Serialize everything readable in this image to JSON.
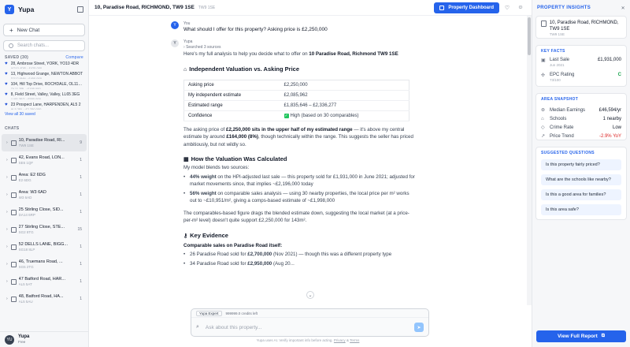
{
  "app": {
    "name": "Yupa",
    "logo_letter": "Y"
  },
  "sidebar": {
    "new_chat": "New Chat",
    "search_placeholder": "Search chats...",
    "saved_label": "SAVED (30)",
    "compare": "Compare",
    "saved": [
      {
        "addr": "28, Ambrose Street, YORK, YO10 4DR",
        "sub": "YO10 4DR · £425,000"
      },
      {
        "addr": "13, Highwood Grange, NEWTON ABBOT",
        "sub": "TQ12 6NN · £450,000"
      },
      {
        "addr": "104, Hill Top Drive, ROCHDALE, OL11 2RL",
        "sub": "OL11 2RL · £195,000"
      },
      {
        "addr": "8, Field Street, Valley, Valley, LL65 3EG",
        "sub": "LL65 3EG · £550,000"
      },
      {
        "addr": "23 Prospect Lane, HARPENDEN, AL5 2",
        "sub": "AL5 2PL · £2,250,000"
      }
    ],
    "view_all": "View all 30 saved",
    "chats_label": "CHATS",
    "chats": [
      {
        "title": "10, Paradise Road, RI...",
        "sub": "TW9 1SE",
        "count": "9"
      },
      {
        "title": "42, Evans Road, LON...",
        "sub": "SE6 1QF",
        "count": "1"
      },
      {
        "title": "Area: E2 6DG",
        "sub": "E2 6DG",
        "count": "1"
      },
      {
        "title": "Area: W3 6AD",
        "sub": "W3 6AD",
        "count": "1"
      },
      {
        "title": "25 Stirling Close, SID...",
        "sub": "DA14 6RP",
        "count": "1"
      },
      {
        "title": "27 Stirling Close, STE...",
        "sub": "SG2 8TG",
        "count": "15"
      },
      {
        "title": "52 DELLS LANE, BIGG...",
        "sub": "SG18 8LP",
        "count": "1"
      },
      {
        "title": "46, Truemans Road, ...",
        "sub": "SG5 2TG",
        "count": "1"
      },
      {
        "title": "47 Batford Road, HAR...",
        "sub": "AL5 5AT",
        "count": "1"
      },
      {
        "title": "48, Batford Road, HA...",
        "sub": "AL5 5AU",
        "count": "1"
      }
    ],
    "user_initials": "YU",
    "user_name": "Yupa",
    "user_plan": "Free"
  },
  "topbar": {
    "address": "10, Paradise Road, RICHMOND, TW9 1SE",
    "postcode": "TW9 1SE",
    "dashboard_btn": "Property Dashboard"
  },
  "conversation": {
    "user_label": "You",
    "user_initial": "Y",
    "user_message": "What should I offer for this property? Asking price is £2,250,000",
    "ai_label": "Yupa",
    "ai_initial": "Y",
    "sources": "Searched 3 sources",
    "intro_pre": "Here's my full analysis to help you decide what to offer on ",
    "intro_bold": "10 Paradise Road, Richmond TW9 1SE",
    "h_valuation": "Independent Valuation vs. Asking Price",
    "table": [
      {
        "k": "Asking price",
        "v": "£2,250,000"
      },
      {
        "k": "My independent estimate",
        "v": "£2,085,962"
      },
      {
        "k": "Estimated range",
        "v": "£1,835,646 – £2,336,277"
      },
      {
        "k": "Confidence",
        "v": "High (based on 30 comparables)"
      }
    ],
    "p2_a": "The asking price of ",
    "p2_b": "£2,250,000 sits in the upper half of my estimated range",
    "p2_c": " — it's above my central estimate by around ",
    "p2_d": "£164,000 (8%)",
    "p2_e": ", though technically within the range. This suggests the seller has priced ambitiously, but not wildly so.",
    "h_calc": "How the Valuation Was Calculated",
    "p3": "My model blends two sources:",
    "b1_bold": "44% weight",
    "b1": " on the HPI-adjusted last sale — this property sold for £1,931,000 in June 2021; adjusted for market movements since, that implies ~£2,196,000 today",
    "b2_bold": "56% weight",
    "b2": " on comparable sales analysis — using 30 nearby properties, the local price per m² works out to ~£10,951/m², giving a comps-based estimate of ~£1,998,000",
    "p4": "The comparables-based figure drags the blended estimate down, suggesting the local market (at a price-per-m² level) doesn't quite support £2,250,000 for 143m².",
    "h_evidence": "Key Evidence",
    "p5": "Comparable sales on Paradise Road itself:",
    "c1_pre": "26 Paradise Road sold for ",
    "c1_bold": "£2,700,000",
    "c1_post": " (Nov 2021) — though this was a different property type",
    "c2_pre": "34 Paradise Road sold for ",
    "c2_bold": "£2,950,000",
    "c2_post": " (Aug 20..."
  },
  "composer": {
    "chip": "Yupa Expert",
    "credits": "999999.0 credits left",
    "placeholder": "Ask about this property..."
  },
  "disclaimer": {
    "text": "Yupa uses AI. Verify important info before acting.",
    "privacy": "Privacy",
    "amp": "&",
    "terms": "Terms"
  },
  "insights": {
    "title": "PROPERTY INSIGHTS",
    "prop_title": "10, Paradise Road, RICHMOND, TW9 1SE",
    "prop_sub": "TW9 1SE",
    "key_facts_label": "KEY FACTS",
    "last_sale_k": "Last Sale",
    "last_sale_s": "Jun 2021",
    "last_sale_v": "£1,931,000",
    "epc_k": "EPC Rating",
    "epc_s": "73/100",
    "epc_v": "C",
    "area_label": "AREA SNAPSHOT",
    "area": [
      {
        "k": "Median Earnings",
        "v": "£46,594/yr"
      },
      {
        "k": "Schools",
        "v": "1 nearby"
      },
      {
        "k": "Crime Rate",
        "v": "Low"
      },
      {
        "k": "Price Trend",
        "v": "-2.9% YoY"
      }
    ],
    "questions_label": "SUGGESTED QUESTIONS",
    "questions": [
      "Is this property fairly priced?",
      "What are the schools like nearby?",
      "Is this a good area for families?",
      "Is this area safe?"
    ],
    "view_report": "View Full Report"
  },
  "colors": {
    "accent": "#2563eb",
    "negative": "#dc2626",
    "positive": "#16a34a"
  }
}
